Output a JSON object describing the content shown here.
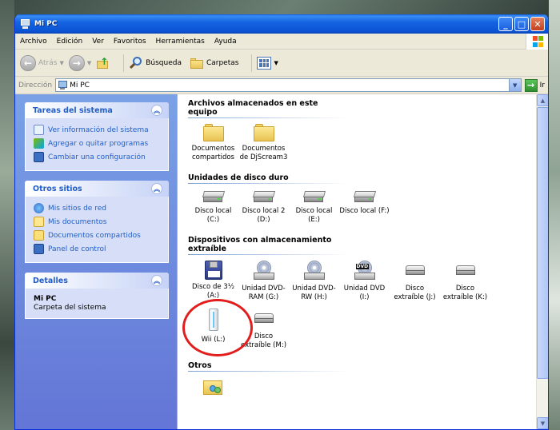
{
  "window": {
    "title": "Mi PC"
  },
  "menu": [
    "Archivo",
    "Edición",
    "Ver",
    "Favoritos",
    "Herramientas",
    "Ayuda"
  ],
  "toolbar": {
    "back_label": "Atrás",
    "search_label": "Búsqueda",
    "folders_label": "Carpetas"
  },
  "address": {
    "label": "Dirección",
    "value": "Mi PC",
    "go_label": "Ir"
  },
  "sidebar": {
    "system_tasks": {
      "title": "Tareas del sistema",
      "items": [
        "Ver información del sistema",
        "Agregar o quitar programas",
        "Cambiar una configuración"
      ]
    },
    "other_places": {
      "title": "Otros sitios",
      "items": [
        "Mis sitios de red",
        "Mis documentos",
        "Documentos compartidos",
        "Panel de control"
      ]
    },
    "details": {
      "title": "Detalles",
      "name": "Mi PC",
      "desc": "Carpeta del sistema"
    }
  },
  "groups": {
    "stored_files": {
      "title": "Archivos almacenados en este equipo",
      "items": [
        "Documentos compartidos",
        "Documentos de DjScream3"
      ]
    },
    "hard_drives": {
      "title": "Unidades de disco duro",
      "items": [
        "Disco local (C:)",
        "Disco local 2 (D:)",
        "Disco local (E:)",
        "Disco local (F:)"
      ]
    },
    "removable": {
      "title": "Dispositivos con almacenamiento extraíble",
      "items": [
        "Disco de 3½ (A:)",
        "Unidad DVD-RAM (G:)",
        "Unidad DVD-RW (H:)",
        "Unidad DVD (I:)",
        "Disco extraíble (J:)",
        "Disco extraíble (K:)",
        "Wii (L:)",
        "Disco extraíble (M:)"
      ]
    },
    "others": {
      "title": "Otros"
    }
  },
  "colors": {
    "highlight_ring": "#e11d1d",
    "title_bar": "#0b54d5",
    "task_link": "#215dc6"
  }
}
